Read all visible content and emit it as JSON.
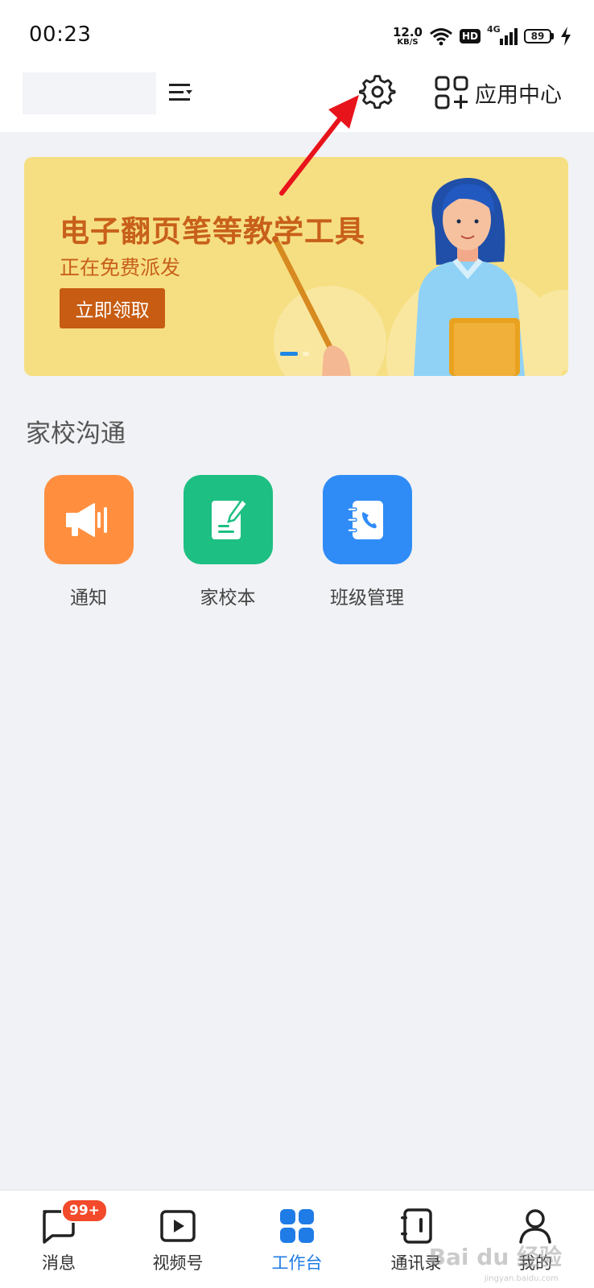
{
  "status_bar": {
    "time": "00:23",
    "net_speed_value": "12.0",
    "net_speed_unit": "KB/S",
    "hd": "HD",
    "network": "4G",
    "battery": "89"
  },
  "header": {
    "app_center_label": "应用中心"
  },
  "banner": {
    "title": "电子翻页笔等教学工具",
    "subtitle": "正在免费派发",
    "button_label": "立即领取"
  },
  "section": {
    "title": "家校沟通",
    "apps": [
      {
        "label": "通知",
        "icon": "megaphone-icon",
        "color": "#ff8f3f"
      },
      {
        "label": "家校本",
        "icon": "notebook-pen-icon",
        "color": "#1ebf82"
      },
      {
        "label": "班级管理",
        "icon": "contact-book-icon",
        "color": "#2f8cf6"
      }
    ]
  },
  "bottom_nav": {
    "items": [
      {
        "label": "消息",
        "icon": "chat-bubble-icon",
        "badge": "99+"
      },
      {
        "label": "视频号",
        "icon": "video-play-icon"
      },
      {
        "label": "工作台",
        "icon": "workbench-grid-icon",
        "active": true
      },
      {
        "label": "通讯录",
        "icon": "address-book-icon"
      },
      {
        "label": "我的",
        "icon": "profile-icon"
      }
    ]
  },
  "watermark": {
    "text": "Bai du 经验",
    "url": "jingyan.baidu.com"
  },
  "colors": {
    "accent": "#1f7ce6",
    "banner_bg": "#f6df82",
    "banner_text": "#c8601a",
    "annotation_arrow": "#e8141c"
  }
}
